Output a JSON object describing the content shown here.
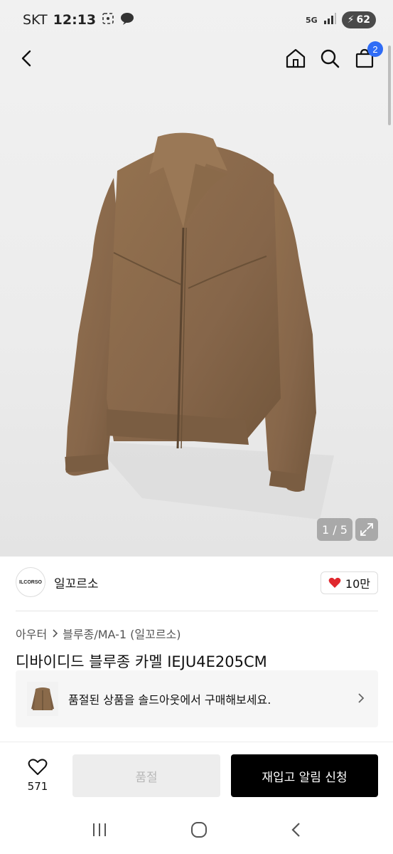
{
  "status_bar": {
    "carrier": "SKT",
    "time": "12:13",
    "network": "5G",
    "battery": "62"
  },
  "nav": {
    "back_icon": "back-arrow-icon",
    "home_icon": "home-icon",
    "search_icon": "search-icon",
    "cart_icon": "cart-icon",
    "cart_count": "2"
  },
  "gallery": {
    "counter": "1 / 5",
    "expand_icon": "expand-icon"
  },
  "brand": {
    "logo_text": "ILCORSO",
    "name": "일꼬르소",
    "likes": "10만",
    "like_color": "#e0282e"
  },
  "breadcrumb": {
    "items": [
      "아우터",
      "블루종/MA-1 (일꼬르소)"
    ]
  },
  "product": {
    "title": "디바이디드 블루종 카멜 IEJU4E205CM",
    "jacket_color": "#8a6a4a"
  },
  "soldout_notice": {
    "text": "품절된 상품을 솔드아웃에서 구매해보세요."
  },
  "actions": {
    "wish_count": "571",
    "soldout_label": "품절",
    "restock_label": "재입고 알림 신청"
  }
}
